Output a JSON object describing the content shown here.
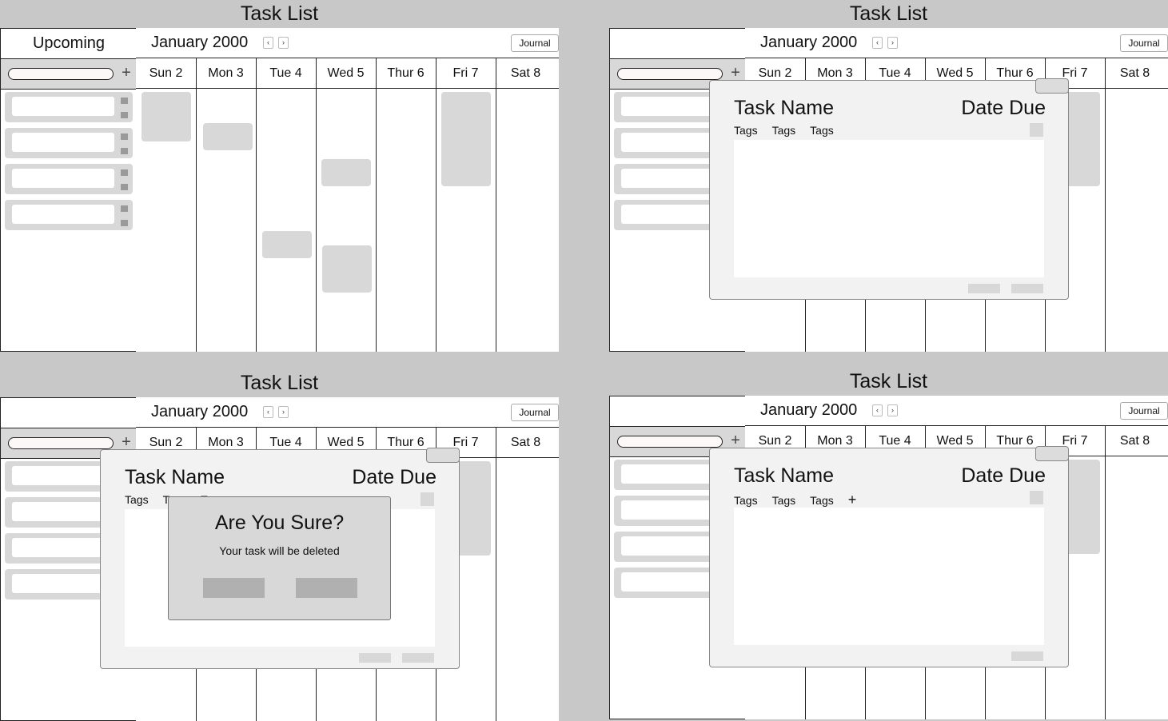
{
  "app": {
    "title": "Task List"
  },
  "sidebar": {
    "heading": "Upcoming",
    "add_icon": "plus-icon"
  },
  "calendar": {
    "month": "January 2000",
    "prev_label": "‹",
    "next_label": "›",
    "journal_label": "Journal",
    "days": [
      "Sun 2",
      "Mon 3",
      "Tue 4",
      "Wed 5",
      "Thur 6",
      "Fri 7",
      "Sat 8"
    ]
  },
  "task_modal": {
    "name": "Task Name",
    "due": "Date Due",
    "tags": [
      "Tags",
      "Tags",
      "Tags"
    ],
    "add_tag_label": "+"
  },
  "confirm_dialog": {
    "title": "Are You Sure?",
    "message": "Your task will be deleted"
  },
  "colors": {
    "background": "#c8c8c8",
    "placeholder": "#d8d8d8",
    "modal": "#f2f2f2",
    "border": "#222222"
  }
}
